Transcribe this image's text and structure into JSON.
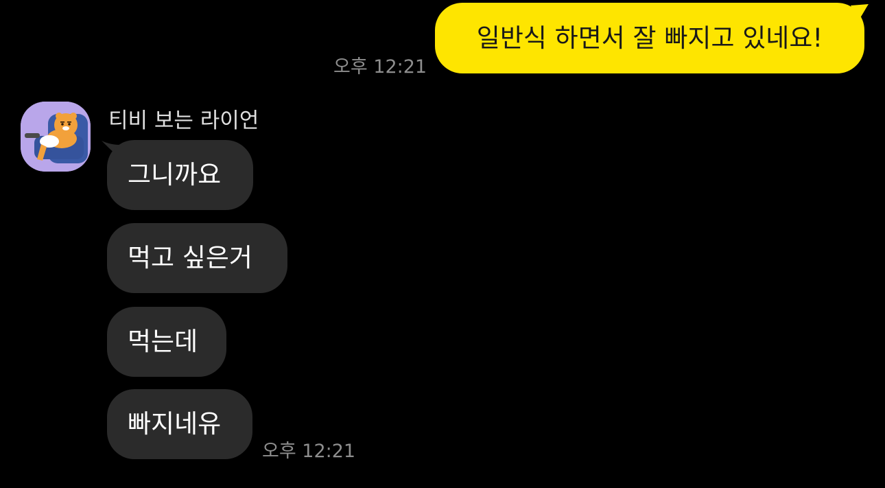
{
  "outgoing": {
    "message": "일반식 하면서 잘 빠지고 있네요!",
    "time": "오후 12:21",
    "bubble_color": "#FEE500"
  },
  "incoming": {
    "sender_name": "티비 보는 라이언",
    "avatar_icon": "ryan-watching-tv-avatar-icon",
    "bubble_color": "#2B2B2B",
    "messages": [
      "그니까요",
      "먹고 싶은거",
      "먹는데",
      "빠지네유"
    ],
    "time": "오후 12:21"
  },
  "colors": {
    "background": "#000000",
    "timestamp": "#8E8E8E"
  }
}
